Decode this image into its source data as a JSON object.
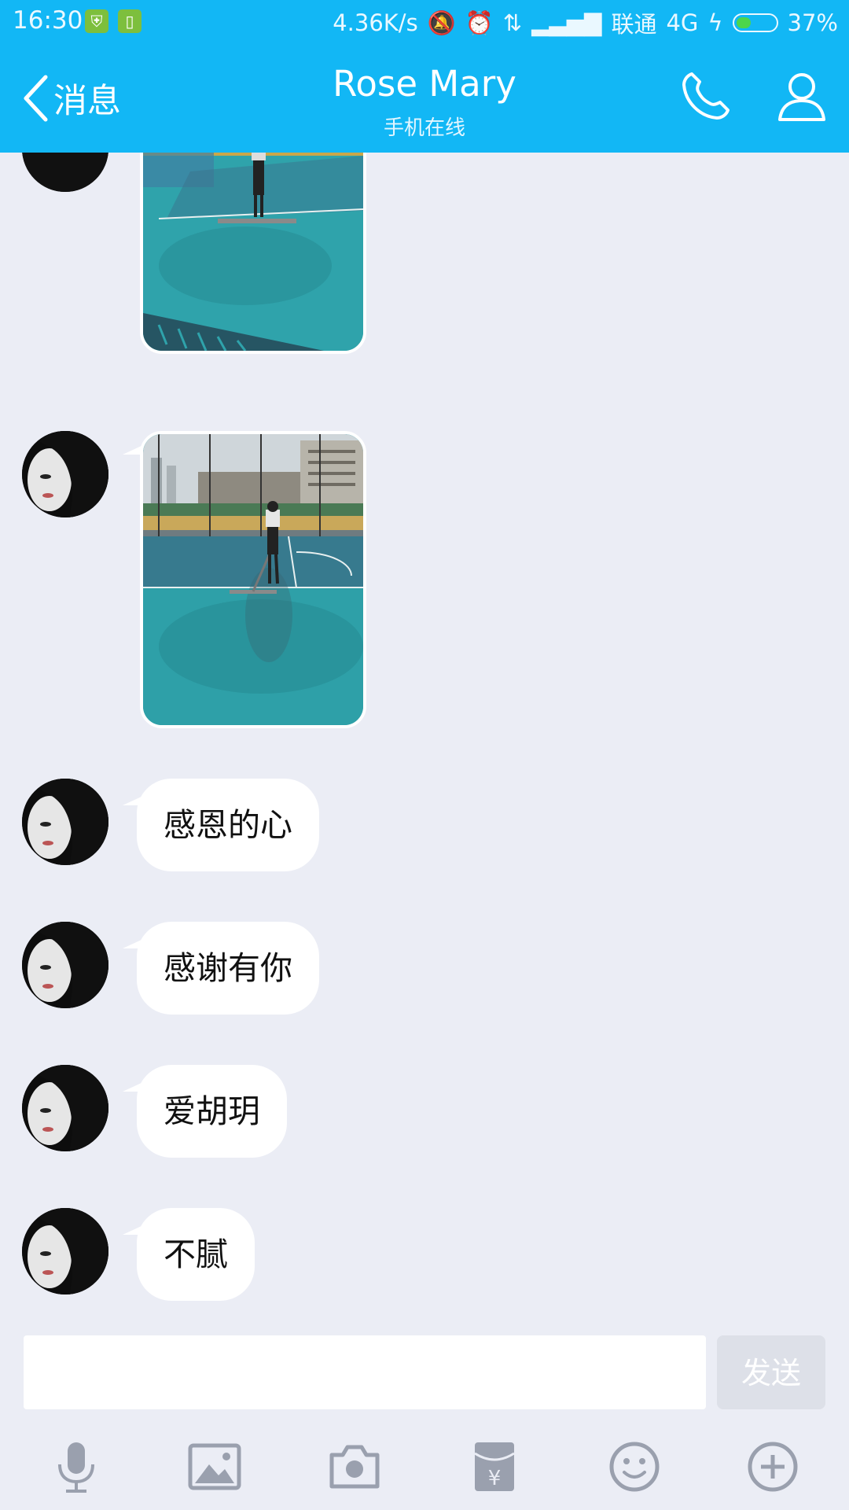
{
  "status_bar": {
    "time": "16:30",
    "network_speed": "4.36K/s",
    "carrier": "联通",
    "network_type": "4G",
    "battery": "37%",
    "battery_level": 0.37
  },
  "nav": {
    "back_label": "消息",
    "title": "Rose Mary",
    "subtitle": "手机在线"
  },
  "messages": [
    {
      "type": "image",
      "sender": "Rose Mary"
    },
    {
      "type": "image",
      "sender": "Rose Mary"
    },
    {
      "type": "text",
      "sender": "Rose Mary",
      "text": "感恩的心"
    },
    {
      "type": "text",
      "sender": "Rose Mary",
      "text": "感谢有你"
    },
    {
      "type": "text",
      "sender": "Rose Mary",
      "text": "爱胡玥"
    },
    {
      "type": "text",
      "sender": "Rose Mary",
      "text": "不腻"
    }
  ],
  "input": {
    "value": "",
    "send_label": "发送"
  },
  "toolbar": [
    "microphone-icon",
    "image-icon",
    "camera-icon",
    "red-packet-icon",
    "emoji-icon",
    "plus-icon"
  ],
  "colors": {
    "accent": "#12b7f5",
    "background": "#ebedf5",
    "bubble": "#ffffff"
  }
}
